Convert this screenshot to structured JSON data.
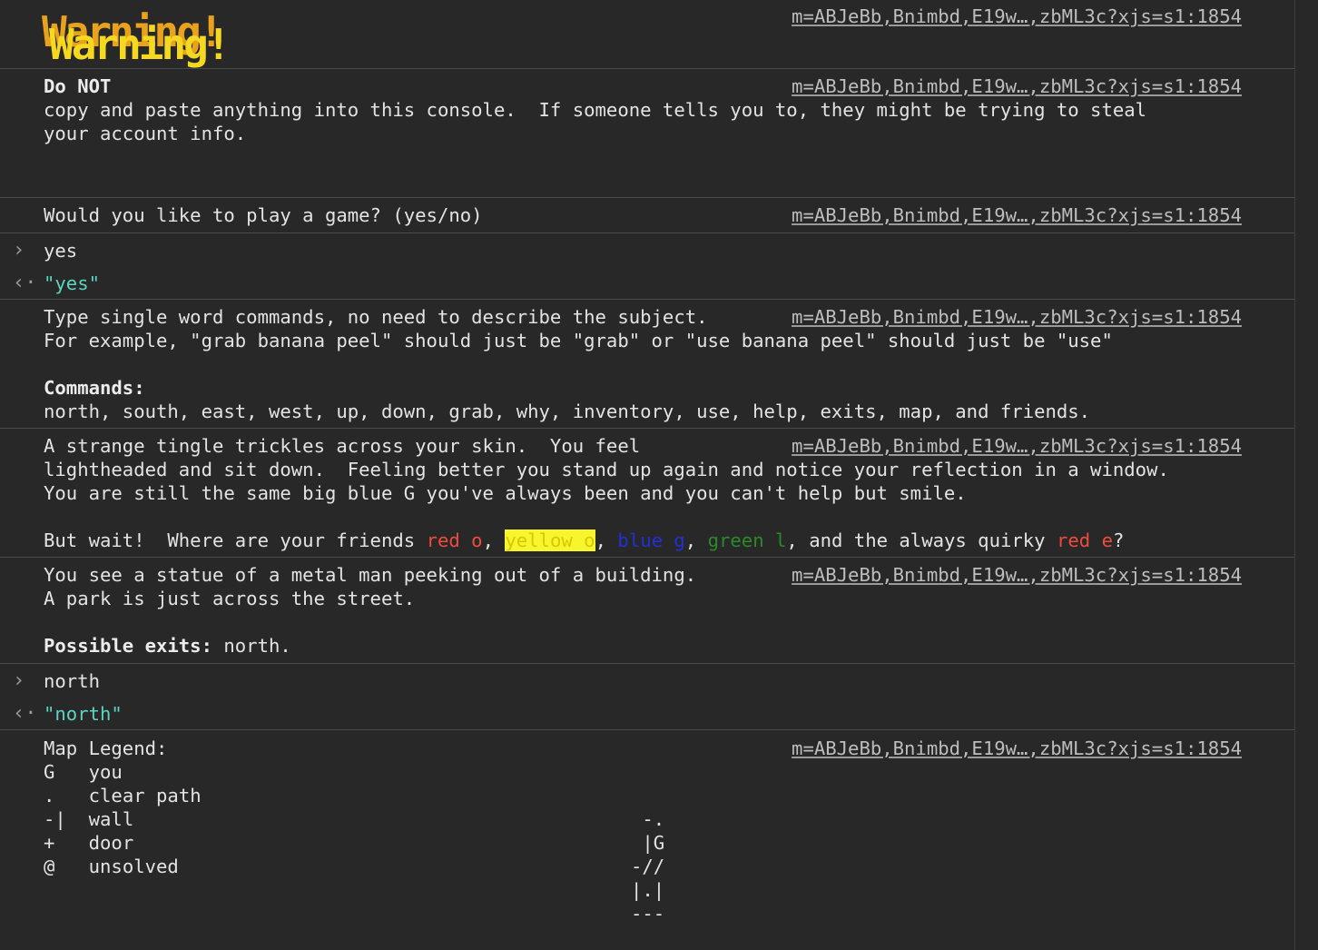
{
  "source_link": "m=ABJeBb,Bnimbd,E19w…,zbML3c?xjs=s1:1854",
  "warning": {
    "banner": "Warning!"
  },
  "do_not": {
    "title": "Do NOT",
    "line1": "copy and paste anything into this console.  If someone tells you to, they might be trying to steal",
    "line2": "your account info."
  },
  "game_prompt": {
    "text": "Would you like to play a game? (yes/no)"
  },
  "input_yes": {
    "command": "yes",
    "result": "\"yes\""
  },
  "instructions": {
    "line1": "Type single word commands, no need to describe the subject.",
    "line2": "For example, \"grab banana peel\" should just be \"grab\" or \"use banana peel\" should just be \"use\"",
    "commands_label": "Commands:",
    "commands_list": "north, south, east, west, up, down, grab, why, inventory, use, help, exits, map, and friends."
  },
  "story": {
    "line1": "A strange tingle trickles across your skin.  You feel",
    "line2": "lightheaded and sit down.  Feeling better you stand up again and notice your reflection in a window.",
    "line3": "You are still the same big blue G you've always been and you can't help but smile.",
    "friends_prefix": "But wait!  Where are your friends ",
    "friend_red_o": "red o",
    "sep1": ", ",
    "friend_yellow_o": "yellow o",
    "sep2": ", ",
    "friend_blue_g": "blue g",
    "sep3": ", ",
    "friend_green_l": "green l",
    "friends_and": ", and the always quirky ",
    "friend_red_e": "red e",
    "friends_end": "?"
  },
  "location": {
    "line1": "You see a statue of a metal man peeking out of a building.",
    "line2": "A park is just across the street.",
    "exits_label": "Possible exits:",
    "exits_value": " north."
  },
  "input_north": {
    "command": "north",
    "result": "\"north\""
  },
  "map": {
    "legend_title": "Map Legend:",
    "legend": [
      {
        "symbol": "G ",
        "meaning": "you"
      },
      {
        "symbol": ". ",
        "meaning": "clear path"
      },
      {
        "symbol": "-|",
        "meaning": "wall"
      },
      {
        "symbol": "+ ",
        "meaning": "door"
      },
      {
        "symbol": "@ ",
        "meaning": "unsolved"
      }
    ],
    "art": [
      " -.",
      " |G",
      "-//",
      "|.|",
      "---"
    ]
  },
  "colors": {
    "background": "#282828",
    "text": "#e3e3e3",
    "string": "#5cd5c0",
    "red": "#ef4b3d",
    "yellow_highlight": "#f7f52e",
    "blue": "#2230d8",
    "green": "#2a8a2a",
    "warning_orange": "#e8a21c",
    "warning_yellow": "#f5d820"
  }
}
